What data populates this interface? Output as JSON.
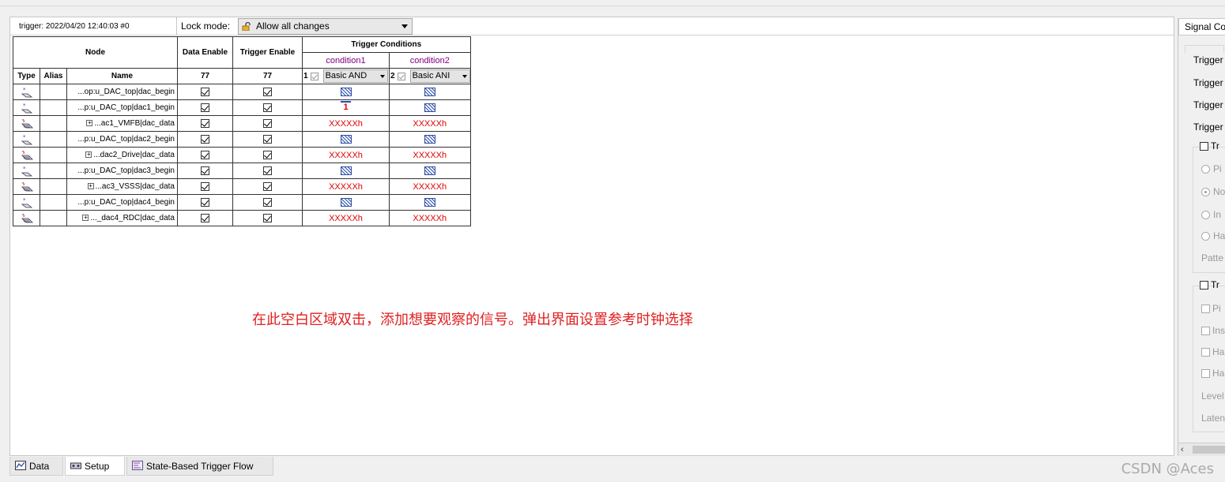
{
  "header": {
    "trigger_info": "trigger: 2022/04/20 12:40:03  #0",
    "lock_mode_label": "Lock mode:",
    "lock_mode_value": "Allow all changes"
  },
  "table": {
    "node_header": "Node",
    "data_enable_header": "Data Enable",
    "trigger_enable_header": "Trigger Enable",
    "trigger_conditions_header": "Trigger Conditions",
    "condition1_label": "condition1",
    "condition2_label": "condition2",
    "type_header": "Type",
    "alias_header": "Alias",
    "name_header": "Name",
    "data_enable_count": "77",
    "trigger_enable_count": "77",
    "cond1_num": "1",
    "cond2_num": "2",
    "cond1_mode": "Basic AND",
    "cond2_mode": "Basic ANI",
    "rows": [
      {
        "type": "wire",
        "expand": false,
        "name": "...op:u_DAC_top|dac_begin",
        "c1": "dontcare",
        "c2": "dontcare"
      },
      {
        "type": "wire",
        "expand": false,
        "name": "...p:u_DAC_top|dac1_begin",
        "c1": "rising",
        "c1_text": "1",
        "c2": "dontcare"
      },
      {
        "type": "bus",
        "expand": true,
        "name": "...ac1_VMFB|dac_data",
        "c1": "XXXXXh",
        "c2": "XXXXXh"
      },
      {
        "type": "wire",
        "expand": false,
        "name": "...p:u_DAC_top|dac2_begin",
        "c1": "dontcare",
        "c2": "dontcare"
      },
      {
        "type": "bus",
        "expand": true,
        "name": "...dac2_Drive|dac_data",
        "c1": "XXXXXh",
        "c2": "XXXXXh"
      },
      {
        "type": "wire",
        "expand": false,
        "name": "...p:u_DAC_top|dac3_begin",
        "c1": "dontcare",
        "c2": "dontcare"
      },
      {
        "type": "bus",
        "expand": true,
        "name": "...ac3_VSSS|dac_data",
        "c1": "XXXXXh",
        "c2": "XXXXXh"
      },
      {
        "type": "wire",
        "expand": false,
        "name": "...p:u_DAC_top|dac4_begin",
        "c1": "dontcare",
        "c2": "dontcare"
      },
      {
        "type": "bus",
        "expand": true,
        "name": "..._dac4_RDC|dac_data",
        "c1": "XXXXXh",
        "c2": "XXXXXh"
      }
    ]
  },
  "annotation": "在此空白区域双击，添加想要观察的信号。弹出界面设置参考时钟选择",
  "bottom_tabs": [
    {
      "label": "Data"
    },
    {
      "label": "Setup"
    },
    {
      "label": "State-Based Trigger Flow"
    }
  ],
  "right_panel": {
    "tab_label": "Signal Co",
    "trigger_lines": [
      "Trigger",
      "Trigger",
      "Trigger",
      "Trigger"
    ],
    "group1_check": "Tr",
    "radios": [
      "Pi",
      "No",
      "In",
      "Ha"
    ],
    "patte": "Patte",
    "group2_check": "Tr",
    "checks": [
      "Pi",
      "Ins",
      "Ha",
      "Ha"
    ],
    "level": "Level",
    "laten": "Laten"
  },
  "watermark": "CSDN @Aces"
}
